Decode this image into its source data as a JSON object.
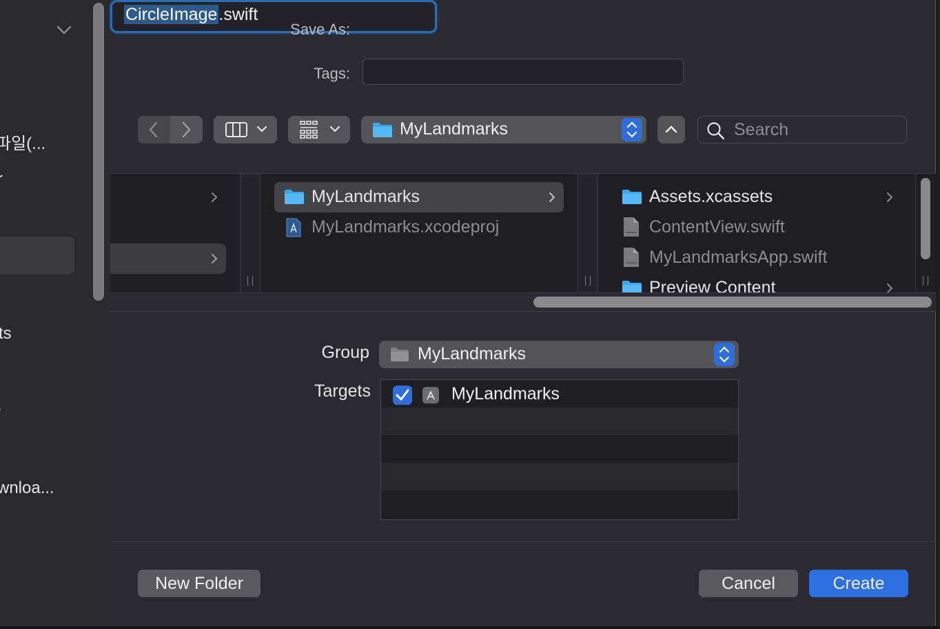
{
  "sidebar": {
    "items": [
      "파일(...",
      "r",
      "ts",
      ".",
      "wnloa..."
    ]
  },
  "form": {
    "save_as_label": "Save As:",
    "save_as_value_selected": "CircleImage",
    "save_as_value_ext": ".swift",
    "tags_label": "Tags:"
  },
  "toolbar": {
    "path_label": "MyLandmarks",
    "search_placeholder": "Search"
  },
  "browser": {
    "column2": [
      {
        "name": "MyLandmarks",
        "type": "folder"
      },
      {
        "name": "MyLandmarks.xcodeproj",
        "type": "xcodeproj"
      }
    ],
    "column3": [
      {
        "name": "Assets.xcassets",
        "type": "folder"
      },
      {
        "name": "ContentView.swift",
        "type": "swift"
      },
      {
        "name": "MyLandmarksApp.swift",
        "type": "swift"
      },
      {
        "name": "Preview Content",
        "type": "folder"
      }
    ]
  },
  "options": {
    "group_label": "Group",
    "group_value": "MyLandmarks",
    "targets_label": "Targets",
    "targets": [
      {
        "name": "MyLandmarks",
        "checked": true
      }
    ]
  },
  "buttons": {
    "new_folder": "New Folder",
    "cancel": "Cancel",
    "create": "Create"
  },
  "colors": {
    "accent": "#2d6fe0",
    "dialog_bg": "#2b2a30",
    "folder_blue": "#3aa8ef"
  }
}
